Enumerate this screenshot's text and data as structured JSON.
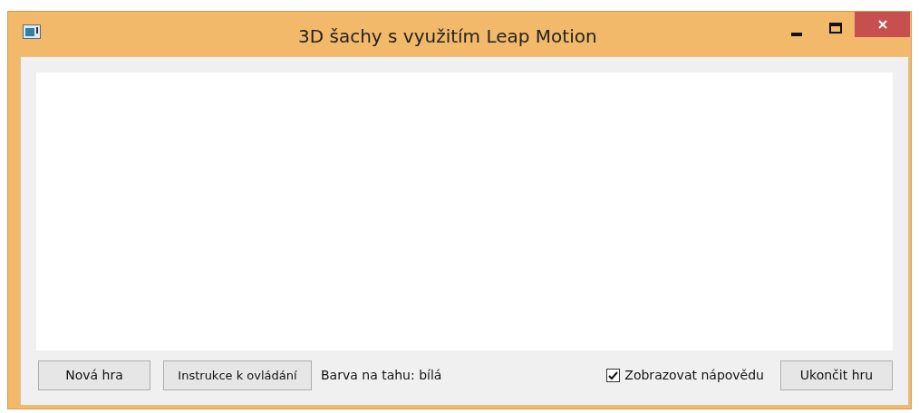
{
  "window": {
    "title": "3D šachy s využitím Leap Motion"
  },
  "toolbar": {
    "new_game": "Nová hra",
    "instructions": "Instrukce k ovládání",
    "turn_label": "Barva na tahu: bílá",
    "show_hints": {
      "label": "Zobrazovat nápovědu",
      "checked": true
    },
    "end_game": "Ukončit hru"
  }
}
